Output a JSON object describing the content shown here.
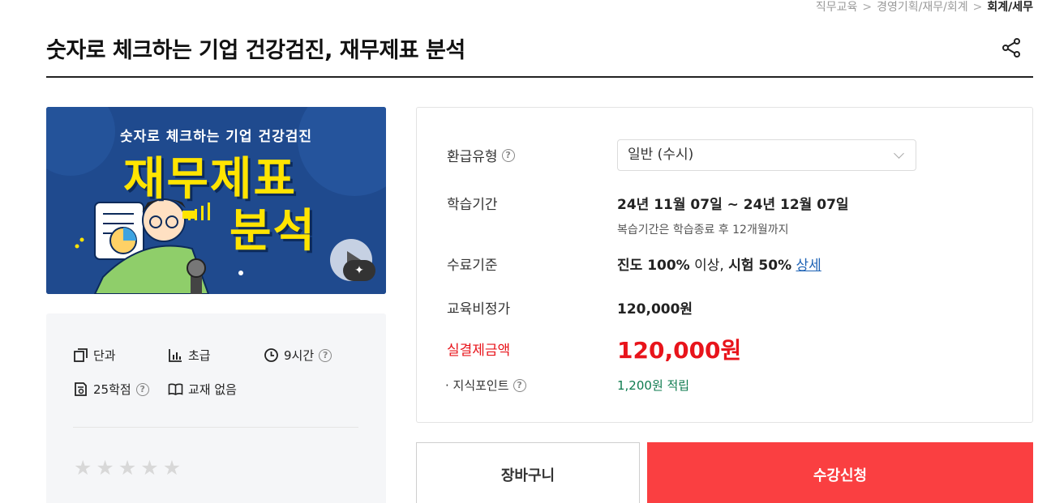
{
  "breadcrumb": [
    "직무교육",
    "경영기획/재무/회계",
    "회계/세무"
  ],
  "title": "숫자로 체크하는 기업 건강검진, 재무제표 분석",
  "thumbnail": {
    "subtitle": "숫자로 체크하는 기업 건강검진",
    "line1": "재무제표",
    "line2": "분석"
  },
  "info": {
    "type": "단과",
    "level": "초급",
    "hours": "9시간",
    "credits": "25학점",
    "textbook": "교재 없음"
  },
  "rating": {
    "stars_filled": 0,
    "stars_total": 5
  },
  "detail": {
    "refund_label": "환급유형",
    "refund_value": "일반 (수시)",
    "period_label": "학습기간",
    "period_value": "24년 11월 07일 ~ 24년 12월 07일",
    "period_note": "복습기간은 학습종료 후 12개월까지",
    "completion_label": "수료기준",
    "completion_progress": "진도 100%",
    "completion_above": "이상,",
    "completion_exam": "시험 50%",
    "completion_link": "상세",
    "fee_label": "교육비정가",
    "fee_value": "120,000원",
    "pay_label": "실결제금액",
    "pay_value": "120,000원",
    "points_label": "· 지식포인트",
    "points_value": "1,200원 적립"
  },
  "buttons": {
    "cart": "장바구니",
    "apply": "수강신청"
  },
  "colors": {
    "accent_red": "#fa3f41",
    "price_red": "#e8141b",
    "points_green": "#0e7b4f",
    "link_blue": "#1e63b5"
  }
}
